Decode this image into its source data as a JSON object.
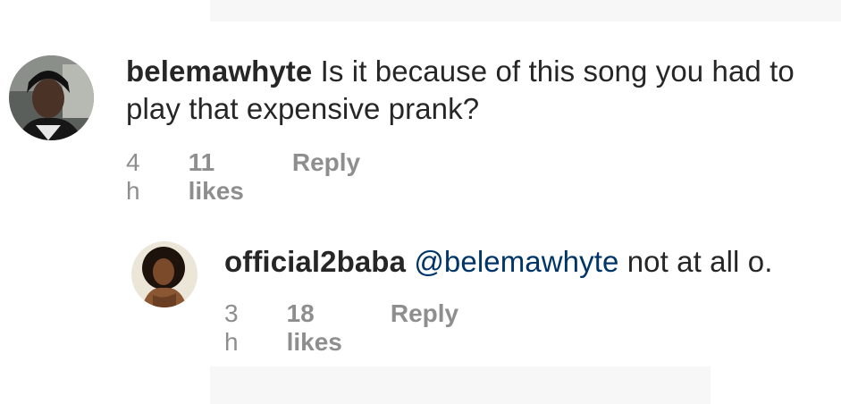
{
  "comments": [
    {
      "username": "belemawhyte",
      "text": "Is it because of this song you had to play that expensive prank?",
      "time": "4 h",
      "likes": "11 likes",
      "reply_label": "Reply",
      "avatar_icon": "user-avatar-photo"
    },
    {
      "username": "official2baba",
      "mention": "@belemawhyte",
      "text": "not at all o.",
      "time": "3 h",
      "likes": "18 likes",
      "reply_label": "Reply",
      "avatar_icon": "user-avatar-photo"
    }
  ],
  "colors": {
    "text": "#262626",
    "meta": "#8e8e8e",
    "mention": "#003569",
    "background": "#ffffff"
  }
}
